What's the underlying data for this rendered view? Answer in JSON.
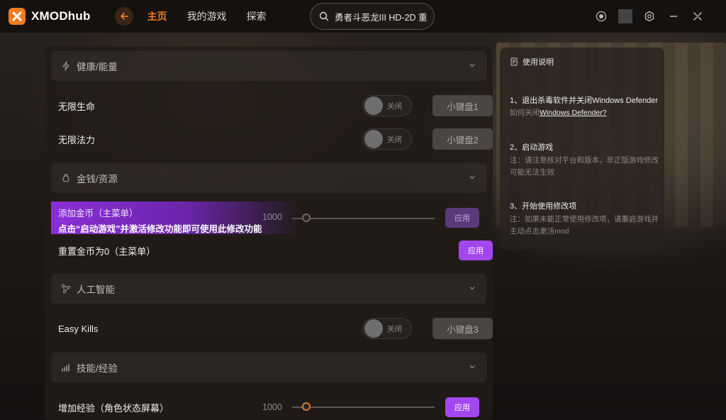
{
  "app": {
    "brand": "XMODhub"
  },
  "nav": {
    "items": [
      {
        "label": "主页",
        "active": true
      },
      {
        "label": "我的游戏",
        "active": false
      },
      {
        "label": "探索",
        "active": false
      }
    ]
  },
  "search": {
    "value": "勇者斗恶龙III HD-2D 重"
  },
  "sections": {
    "health": {
      "title": "健康/能量"
    },
    "money": {
      "title": "金钱/资源"
    },
    "ai": {
      "title": "人工智能"
    },
    "skills": {
      "title": "技能/经验"
    }
  },
  "mods": {
    "infinite_hp": {
      "label": "无限生命",
      "toggle": "关闭",
      "key": "小键盘1"
    },
    "infinite_mp": {
      "label": "无限法力",
      "toggle": "关闭",
      "key": "小键盘2"
    },
    "add_gold": {
      "label": "添加金币（主菜单）",
      "note": "点击“启动游戏”并激活修改功能即可使用此修改功能",
      "value": "1000",
      "apply": "应用",
      "level": 0
    },
    "reset_gold": {
      "label": "重置金币为0（主菜单）",
      "apply": "应用"
    },
    "easy_kills": {
      "label": "Easy Kills",
      "toggle": "关闭",
      "key": "小键盘3"
    },
    "add_exp": {
      "label": "增加经验（角色状态屏幕）",
      "value": "1000",
      "apply": "应用",
      "level": 0
    }
  },
  "guide": {
    "title": "使用说明",
    "step1": "1、退出杀毒软件并关闭Windows Defender",
    "step1_link_prefix": "如何关闭",
    "step1_link": "Windows Defender?",
    "step2": "2、启动游戏",
    "step2_note": "注：请注意核对平台和版本，非正版游戏修改可能无法生效",
    "step3": "3、开始使用修改项",
    "step3_note": "注：如果未能正常使用修改项，请重启游戏并主动点击激活mod"
  },
  "colors": {
    "accent": "#f07b1f",
    "apply": "#a446f0"
  }
}
